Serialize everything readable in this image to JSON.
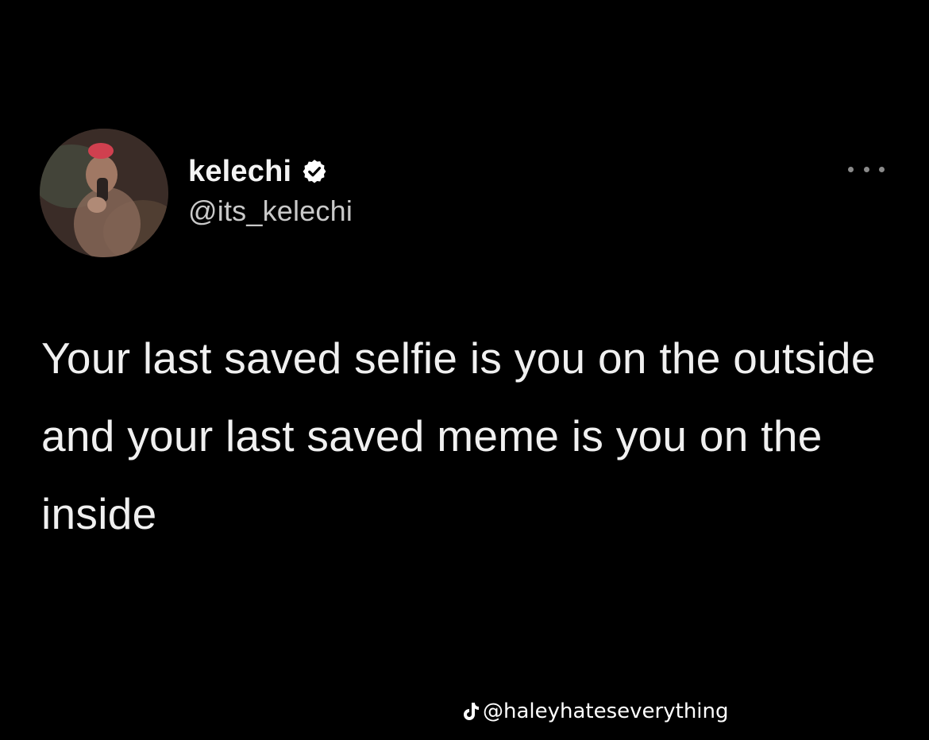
{
  "tweet": {
    "author": {
      "display_name": "kelechi",
      "handle": "@its_kelechi",
      "verified": true,
      "avatar_icon": "profile-photo"
    },
    "more_icon": "more-horizontal-icon",
    "text": "Your last saved selfie is you on the outside and your last saved meme is you on the inside"
  },
  "watermark": {
    "icon": "tiktok-icon",
    "text": "@haleyhateseverything"
  },
  "colors": {
    "background": "#000000",
    "text": "#f0f0f0",
    "handle": "#c9c9c9",
    "verified_badge": "#ffffff"
  }
}
